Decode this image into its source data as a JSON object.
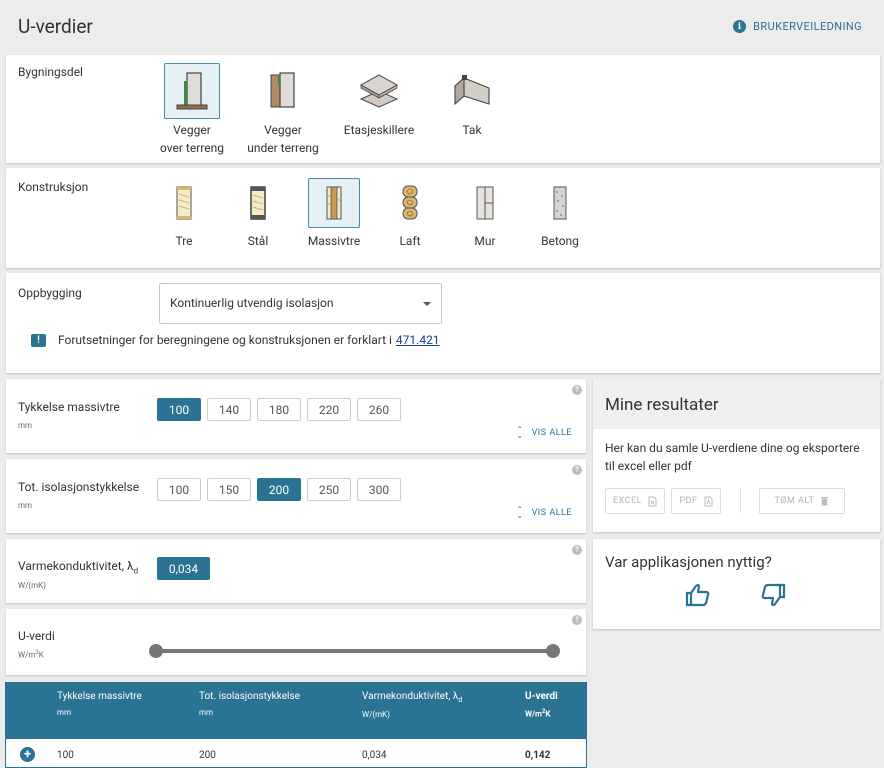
{
  "header": {
    "title": "U-verdier",
    "guide_label": "BRUKERVEILEDNING",
    "info_glyph": "i"
  },
  "bygningsdel": {
    "label": "Bygningsdel",
    "items": [
      {
        "line1": "Vegger",
        "line2": "over terreng",
        "selected": true,
        "icon": "wall-above-ground-icon"
      },
      {
        "line1": "Vegger",
        "line2": "under terreng",
        "selected": false,
        "icon": "wall-below-ground-icon"
      },
      {
        "line1": "Etasjeskillere",
        "line2": "",
        "selected": false,
        "icon": "floor-divider-icon"
      },
      {
        "line1": "Tak",
        "line2": "",
        "selected": false,
        "icon": "roof-icon"
      }
    ]
  },
  "konstruksjon": {
    "label": "Konstruksjon",
    "items": [
      {
        "label": "Tre",
        "selected": false,
        "icon": "wood-frame-icon"
      },
      {
        "label": "Stål",
        "selected": false,
        "icon": "steel-frame-icon"
      },
      {
        "label": "Massivtre",
        "selected": true,
        "icon": "solid-wood-icon"
      },
      {
        "label": "Laft",
        "selected": false,
        "icon": "log-icon"
      },
      {
        "label": "Mur",
        "selected": false,
        "icon": "masonry-icon"
      },
      {
        "label": "Betong",
        "selected": false,
        "icon": "concrete-icon"
      }
    ]
  },
  "oppbygging": {
    "label": "Oppbygging",
    "selected_value": "Kontinuerlig utvendig isolasjon",
    "note_glyph": "!",
    "note_text": "Forutsetninger for beregningene og konstruksjonen er forklart i",
    "note_link": "471.421"
  },
  "thickness": {
    "label": "Tykkelse massivtre",
    "unit": "mm",
    "options": [
      "100",
      "140",
      "180",
      "220",
      "260"
    ],
    "active": "100",
    "show_all": "VIS ALLE"
  },
  "insulation": {
    "label": "Tot. isolasjonstykkelse",
    "unit": "mm",
    "options": [
      "100",
      "150",
      "200",
      "250",
      "300"
    ],
    "active": "200",
    "show_all": "VIS ALLE"
  },
  "conductivity": {
    "label_main": "Varmekonduktivitet, λ",
    "label_sub": "d",
    "unit": "W/(mK)",
    "value": "0,034"
  },
  "uvalue": {
    "label": "U-verdi",
    "unit_main": "W/m",
    "unit_sup": "2",
    "unit_tail": "K"
  },
  "help_glyph": "?",
  "results": {
    "title": "Mine resultater",
    "description": "Her kan du samle U-verdiene dine og eksportere til excel eller pdf",
    "excel": "EXCEL",
    "pdf": "PDF",
    "clear": "TØM ALT"
  },
  "feedback": {
    "title": "Var applikasjonen nyttig?"
  },
  "table": {
    "headers": [
      {
        "label": "Tykkelse massivtre",
        "unit": "mm"
      },
      {
        "label": "Tot. isolasjonstykkelse",
        "unit": "mm"
      },
      {
        "label": "Varmekonduktivitet, λ",
        "sub": "d",
        "unit": "W/(mK)"
      },
      {
        "label": "U-verdi",
        "unit_main": "W/m",
        "unit_sup": "2",
        "unit_tail": "K"
      }
    ],
    "row": {
      "thickness": "100",
      "insulation": "200",
      "conductivity": "0,034",
      "u_value": "0,142"
    },
    "add_glyph": "+"
  },
  "colors": {
    "accent": "#2a7393",
    "link": "#1a3d9c",
    "background": "#ececec"
  }
}
